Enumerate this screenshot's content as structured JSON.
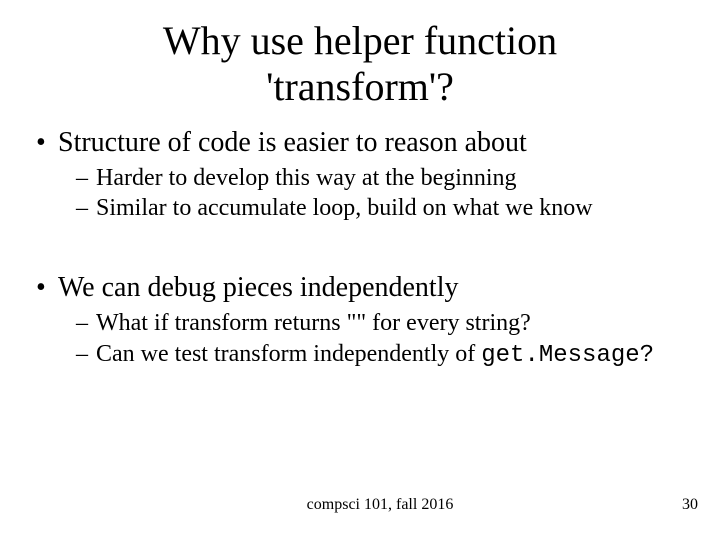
{
  "title_line1": "Why use helper function",
  "title_line2": "'transform'?",
  "bullets": [
    {
      "text": "Structure of code is easier to reason about",
      "sub": [
        "Harder to develop this way at the beginning",
        "Similar to accumulate loop, build on what we know"
      ]
    },
    {
      "text": "We can debug pieces independently",
      "sub": [
        "What if transform returns \"\" for every string?",
        "Can we test transform independently of "
      ]
    }
  ],
  "code_tail": "get.Message?",
  "footer_course": "compsci 101, fall 2016",
  "slide_number": "30"
}
